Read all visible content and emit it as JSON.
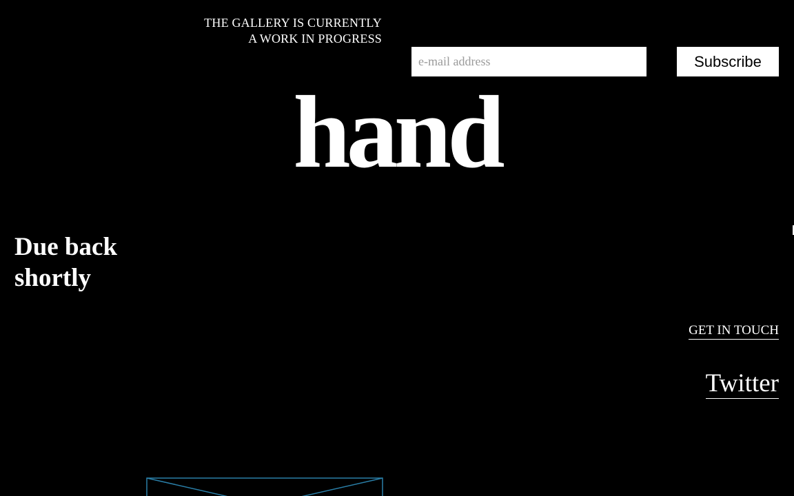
{
  "notice": {
    "line1": "THE GALLERY IS CURRENTLY",
    "line2": "A WORK IN PROGRESS"
  },
  "subscribe": {
    "email_placeholder": "e-mail address",
    "button_label": "Subscribe"
  },
  "logo": {
    "text": "hand"
  },
  "tagline": {
    "line1": "Due back",
    "line2": "shortly"
  },
  "contact": {
    "label": "GET IN TOUCH"
  },
  "social": {
    "twitter_label": "Twitter"
  },
  "icons": {
    "envelope": "envelope-icon"
  },
  "colors": {
    "background": "#000000",
    "text": "#ffffff",
    "envelope_stroke": "#2a7fa8"
  }
}
